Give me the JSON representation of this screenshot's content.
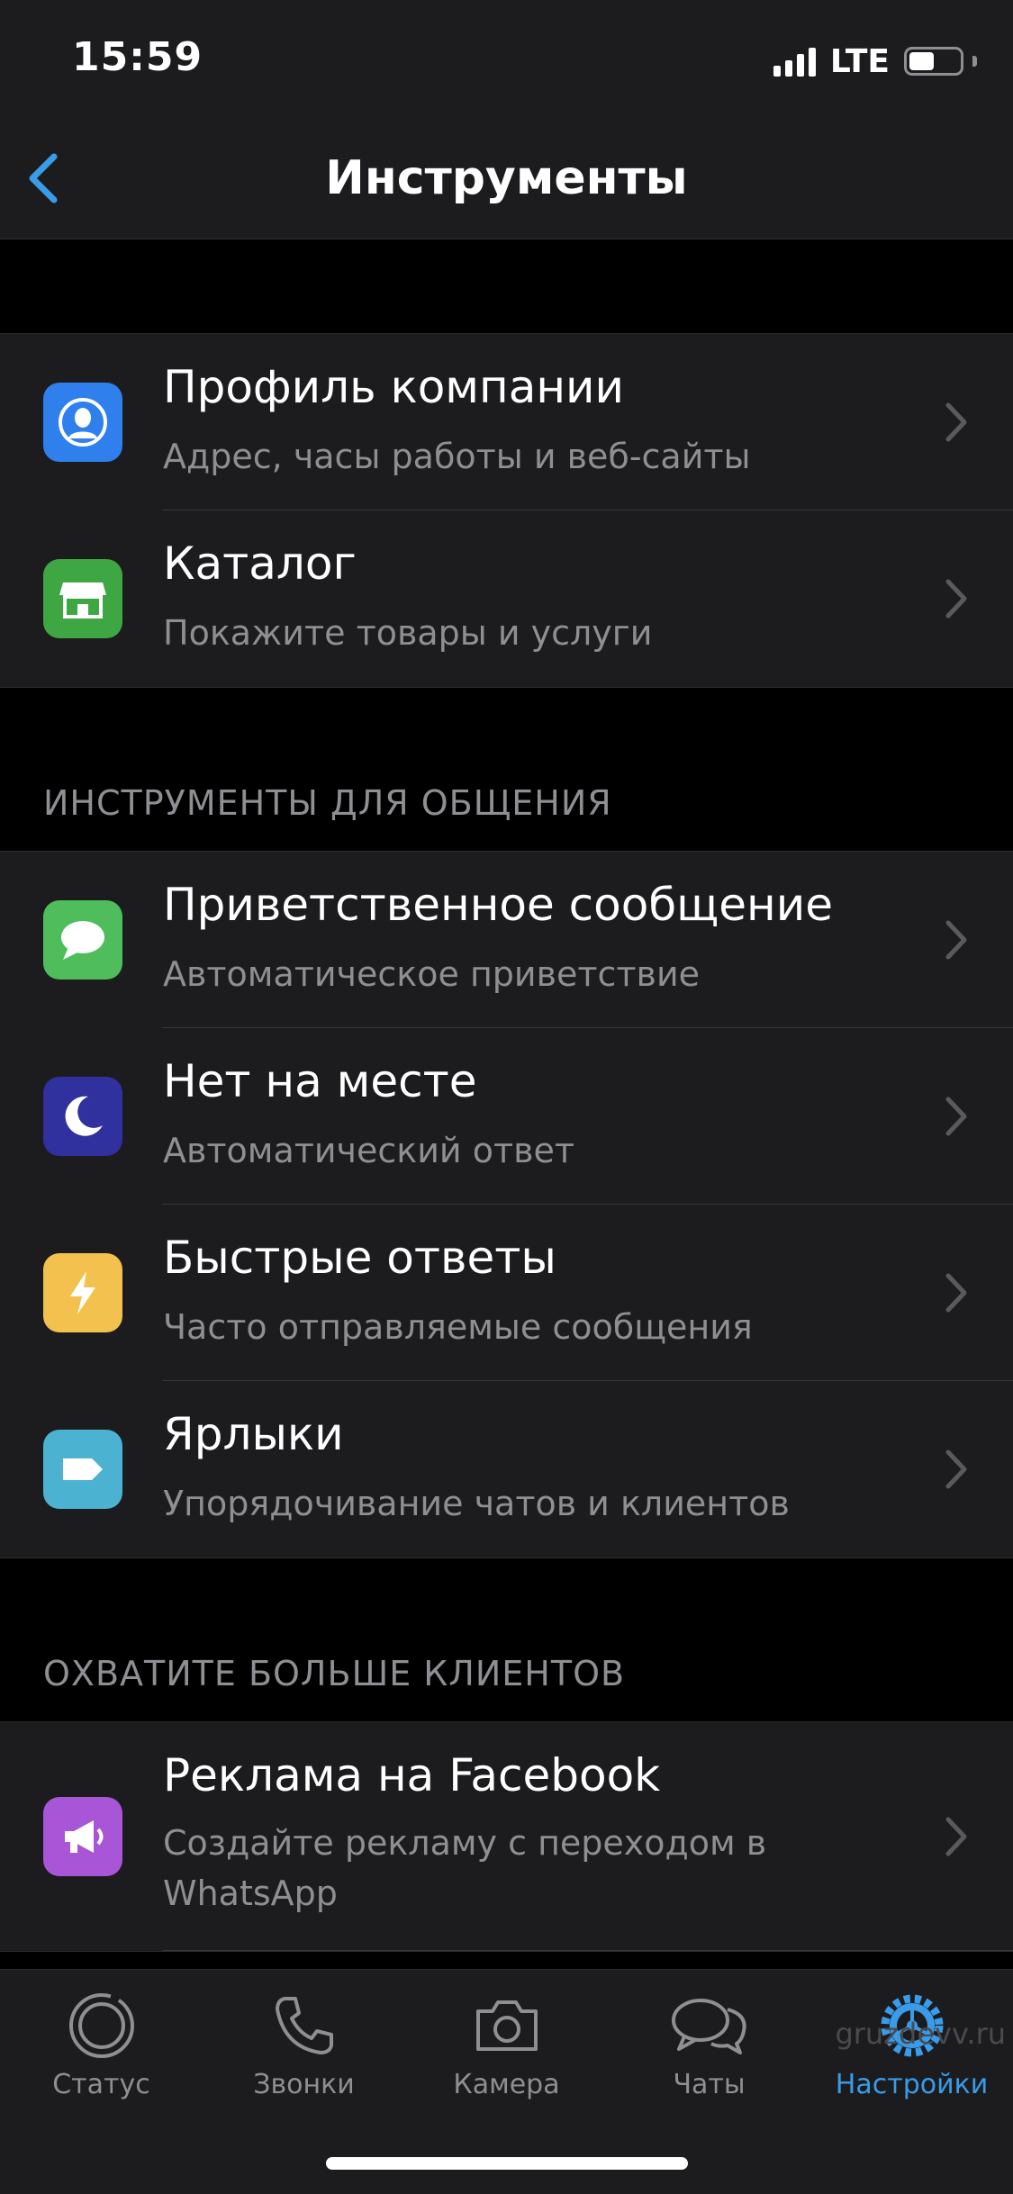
{
  "status_bar": {
    "time": "15:59",
    "network": "LTE",
    "battery_level": 0.5
  },
  "nav": {
    "title": "Инструменты",
    "back_icon": "chevron-left-icon",
    "accent": "#3a9be8"
  },
  "sections": [
    {
      "header": "",
      "items": [
        {
          "title": "Профиль компании",
          "subtitle": "Адрес, часы работы и веб-сайты",
          "icon": "profile-icon",
          "icon_color": "#2f80ed"
        },
        {
          "title": "Каталог",
          "subtitle": "Покажите товары и услуги",
          "icon": "storefront-icon",
          "icon_color": "#3ea743"
        }
      ]
    },
    {
      "header": "ИНСТРУМЕНТЫ ДЛЯ ОБЩЕНИЯ",
      "items": [
        {
          "title": "Приветственное сообщение",
          "subtitle": "Автоматическое приветствие",
          "icon": "message-bubble-icon",
          "icon_color": "#4fbd5b"
        },
        {
          "title": "Нет на месте",
          "subtitle": "Автоматический ответ",
          "icon": "moon-icon",
          "icon_color": "#30309e"
        },
        {
          "title": "Быстрые ответы",
          "subtitle": "Часто отправляемые сообщения",
          "icon": "lightning-icon",
          "icon_color": "#f2c14e"
        },
        {
          "title": "Ярлыки",
          "subtitle": "Упорядочивание чатов и клиентов",
          "icon": "label-tag-icon",
          "icon_color": "#4bb3d1"
        }
      ]
    },
    {
      "header": "ОХВАТИТЕ БОЛЬШЕ КЛИЕНТОВ",
      "items": [
        {
          "title": "Реклама на Facebook",
          "subtitle": "Создайте рекламу с переходом в WhatsApp",
          "icon": "megaphone-icon",
          "icon_color": "#a855d8"
        }
      ]
    }
  ],
  "tabs": [
    {
      "label": "Статус",
      "icon": "status-icon",
      "active": false
    },
    {
      "label": "Звонки",
      "icon": "phone-icon",
      "active": false
    },
    {
      "label": "Камера",
      "icon": "camera-icon",
      "active": false
    },
    {
      "label": "Чаты",
      "icon": "chats-icon",
      "active": false
    },
    {
      "label": "Настройки",
      "icon": "gear-icon",
      "active": true
    }
  ],
  "watermark": "gruzdevv.ru"
}
